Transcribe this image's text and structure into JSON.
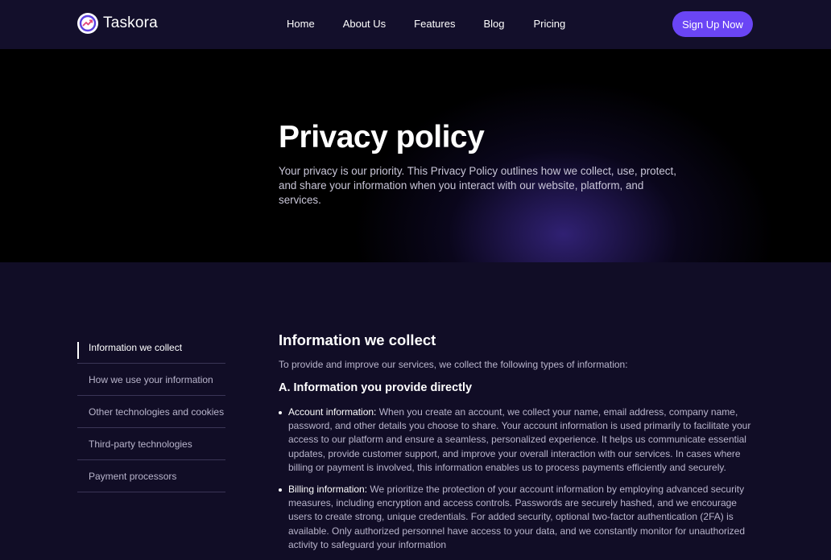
{
  "brand": {
    "name": "Taskora",
    "logo_icon": "chart-ring-icon"
  },
  "nav": {
    "links": [
      "Home",
      "About Us",
      "Features",
      "Blog",
      "Pricing"
    ],
    "cta": "Sign Up Now"
  },
  "hero": {
    "title": "Privacy policy",
    "subtitle": "Your privacy is our priority. This Privacy Policy outlines how we collect, use, protect, and share your information when you interact with our website, platform, and services."
  },
  "toc": {
    "items": [
      "Information we collect",
      "How we use your information",
      "Other technologies and cookies",
      "Third-party technologies",
      "Payment processors"
    ],
    "active_index": 0
  },
  "section": {
    "heading": "Information we collect",
    "intro": "To provide and improve our services, we collect the following types of information:",
    "subheading": "A. Information you provide directly",
    "bullets": [
      {
        "term": "Account information:",
        "text": " When you create an account, we collect your name, email address, company name, password, and other details you choose to share. Your account information is used primarily to facilitate your access to our platform and ensure a seamless, personalized experience. It helps us communicate essential updates, provide customer support, and improve your overall interaction with our services. In cases where billing or payment is involved, this information enables us to process payments efficiently and securely."
      },
      {
        "term": "Billing information:",
        "text": " We prioritize the protection of your account information by employing advanced security measures, including encryption and access controls. Passwords are securely hashed, and we encourage users to create strong, unique credentials. For added security, optional two-factor authentication (2FA) is available. Only authorized personnel have access to your data, and we constantly monitor for unauthorized activity to safeguard your information"
      }
    ]
  },
  "colors": {
    "accent": "#6a45f5",
    "background": "#110d26",
    "hero_bg": "#000000"
  }
}
